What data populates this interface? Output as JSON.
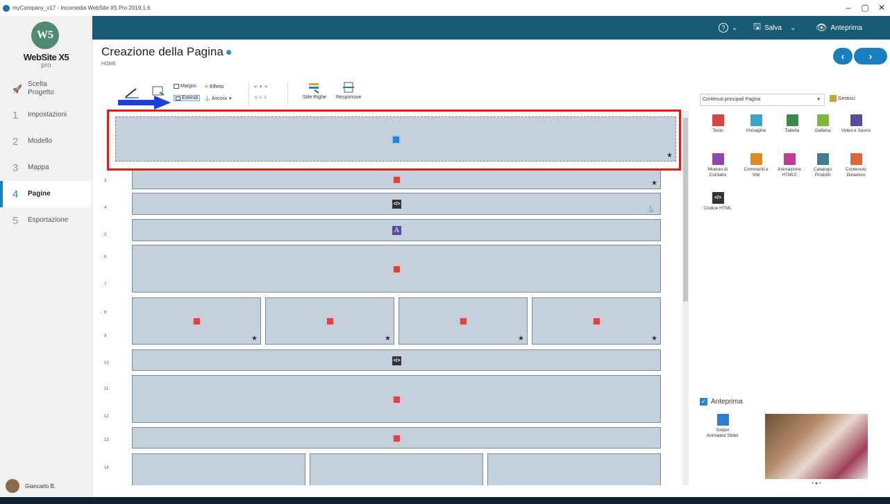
{
  "window": {
    "title": "myCompany_v17 - Incomedia WebSite X5 Pro 2019.1.6",
    "controls": [
      "–",
      "▢",
      "✕"
    ]
  },
  "logo": {
    "mark": "W5",
    "brand": "WebSite X5",
    "edition": "pro"
  },
  "sidebar": {
    "items": [
      {
        "num": "🚀",
        "label": "Scelta Progetto",
        "active": false
      },
      {
        "num": "1",
        "label": "Impostazioni",
        "active": false
      },
      {
        "num": "2",
        "label": "Modello",
        "active": false
      },
      {
        "num": "3",
        "label": "Mappa",
        "active": false
      },
      {
        "num": "4",
        "label": "Pagine",
        "active": true
      },
      {
        "num": "5",
        "label": "Esportazione",
        "active": false
      }
    ],
    "user": "Giancarlo B."
  },
  "topbar": {
    "help_icon": "?",
    "save_label": "Salva",
    "preview_label": "Anteprima"
  },
  "header": {
    "title": "Creazione della Pagina",
    "breadcrumb": "HOME"
  },
  "toolbar": {
    "margini": "Margini",
    "effetto": "Effetto",
    "estendi": "Estendi",
    "ancora": "Ancora",
    "stile_righe": "Stile Righe",
    "responsive": "Responsive"
  },
  "canvas": {
    "row_numbers": [
      "3",
      "4",
      "5",
      "6",
      "7",
      "8",
      "9",
      "10",
      "11",
      "12",
      "13",
      "14"
    ]
  },
  "rightpanel": {
    "selector": "Contenuti principali Pagina",
    "manage": "Gestisci",
    "objects": [
      {
        "name": "text",
        "label": "Testo",
        "color": "#d64545"
      },
      {
        "name": "image",
        "label": "Immagine",
        "color": "#3aa7c9"
      },
      {
        "name": "table",
        "label": "Tabella",
        "color": "#3a8a4a"
      },
      {
        "name": "gallery",
        "label": "Galleria",
        "color": "#7cba3a"
      },
      {
        "name": "video",
        "label": "Video e Suono",
        "color": "#5b4a9c"
      },
      {
        "name": "contact-form",
        "label": "Modulo di Contatto",
        "color": "#8a4aa8"
      },
      {
        "name": "comments",
        "label": "Commenti e Voti",
        "color": "#e08a1e"
      },
      {
        "name": "animation",
        "label": "Animazione HTML5",
        "color": "#c43a9a"
      },
      {
        "name": "catalog",
        "label": "Catalogo Prodotti",
        "color": "#3f7f8f"
      },
      {
        "name": "dynamic",
        "label": "Contenuto Dinamico",
        "color": "#e0663a"
      },
      {
        "name": "html-code",
        "label": "Codice HTML",
        "color": "#333333"
      }
    ],
    "preview_label": "Anteprima",
    "swiper_label": "Swiper Animated Slider",
    "slider_dots": "• ● •"
  }
}
